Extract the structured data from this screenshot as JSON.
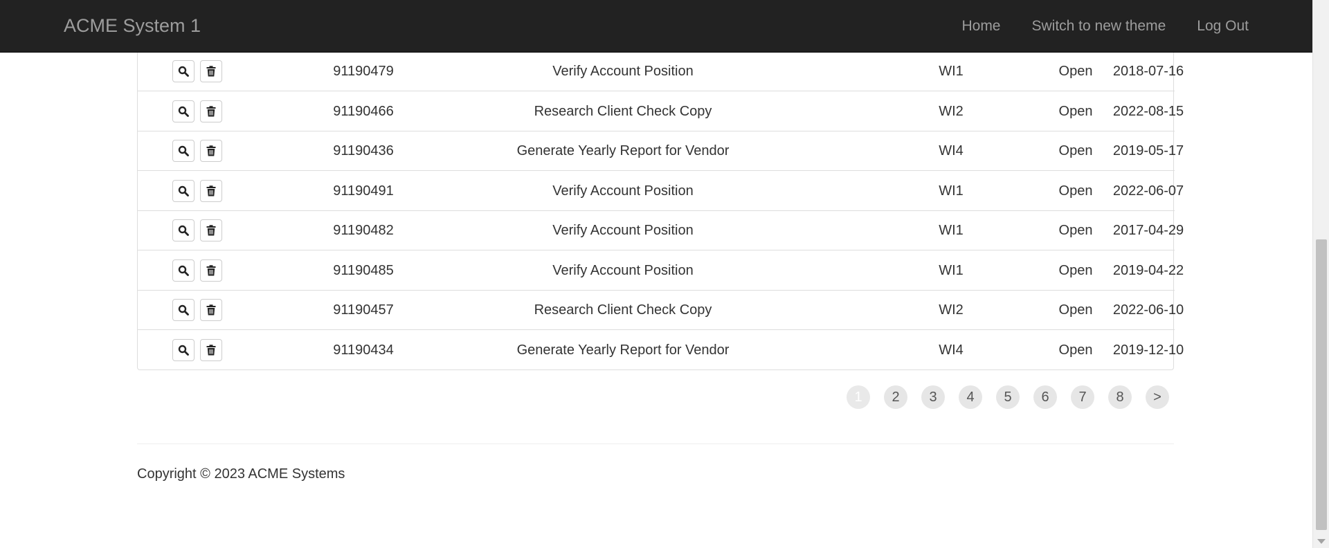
{
  "navbar": {
    "brand": "ACME System 1",
    "links": [
      "Home",
      "Switch to new theme",
      "Log Out"
    ]
  },
  "table": {
    "rows": [
      {
        "id": "91190479",
        "title": "Verify Account Position",
        "type": "WI1",
        "status": "Open",
        "date": "2018-07-16"
      },
      {
        "id": "91190466",
        "title": "Research Client Check Copy",
        "type": "WI2",
        "status": "Open",
        "date": "2022-08-15"
      },
      {
        "id": "91190436",
        "title": "Generate Yearly Report for Vendor",
        "type": "WI4",
        "status": "Open",
        "date": "2019-05-17"
      },
      {
        "id": "91190491",
        "title": "Verify Account Position",
        "type": "WI1",
        "status": "Open",
        "date": "2022-06-07"
      },
      {
        "id": "91190482",
        "title": "Verify Account Position",
        "type": "WI1",
        "status": "Open",
        "date": "2017-04-29"
      },
      {
        "id": "91190485",
        "title": "Verify Account Position",
        "type": "WI1",
        "status": "Open",
        "date": "2019-04-22"
      },
      {
        "id": "91190457",
        "title": "Research Client Check Copy",
        "type": "WI2",
        "status": "Open",
        "date": "2022-06-10"
      },
      {
        "id": "91190434",
        "title": "Generate Yearly Report for Vendor",
        "type": "WI4",
        "status": "Open",
        "date": "2019-12-10"
      }
    ],
    "row_icons": {
      "view": "search-icon",
      "delete": "trash-icon"
    }
  },
  "pagination": {
    "pages": [
      "1",
      "2",
      "3",
      "4",
      "5",
      "6",
      "7",
      "8",
      ">"
    ],
    "current": "1"
  },
  "footer": {
    "copyright": "Copyright © 2023 ACME Systems"
  }
}
